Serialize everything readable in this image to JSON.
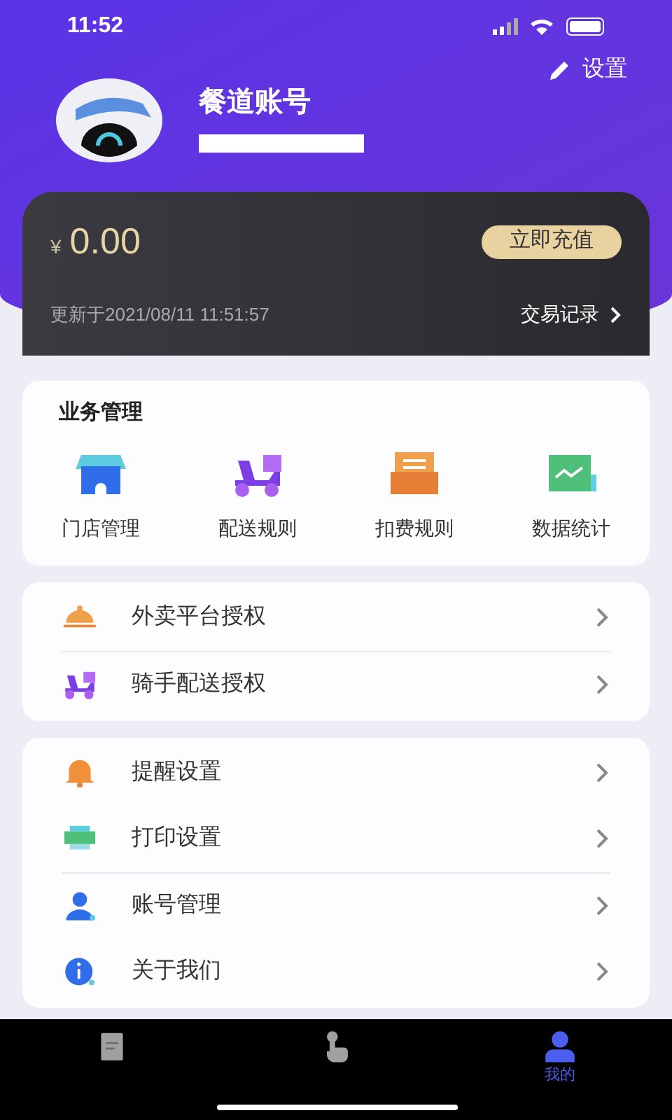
{
  "status_bar": {
    "time": "11:52"
  },
  "header": {
    "settings_label": "设置",
    "account_name": "餐道账号"
  },
  "wallet": {
    "currency": "¥",
    "balance": "0.00",
    "recharge_button": "立即充值",
    "updated": "更新于2021/08/11 11:51:57",
    "transactions_link": "交易记录"
  },
  "business": {
    "title": "业务管理",
    "items": [
      {
        "kind": "store",
        "label": "门店管理"
      },
      {
        "kind": "scooter",
        "label": "配送规则"
      },
      {
        "kind": "bill",
        "label": "扣费规则"
      },
      {
        "kind": "chart",
        "label": "数据统计"
      }
    ]
  },
  "auth_menu": [
    {
      "kind": "cloche",
      "label": "外卖平台授权"
    },
    {
      "kind": "scooter",
      "label": "骑手配送授权"
    }
  ],
  "settings_menu": [
    {
      "kind": "bell",
      "label": "提醒设置"
    },
    {
      "kind": "printer",
      "label": "打印设置"
    },
    {
      "kind": "person",
      "label": "账号管理"
    },
    {
      "kind": "info",
      "label": "关于我们"
    }
  ],
  "tabs": [
    {
      "kind": "orders",
      "selected": false
    },
    {
      "kind": "tap",
      "selected": false
    },
    {
      "kind": "mine",
      "label": "我的",
      "selected": true
    }
  ]
}
